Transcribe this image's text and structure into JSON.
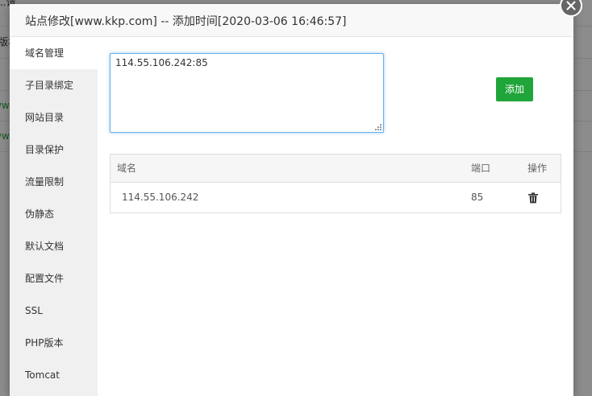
{
  "background": {
    "lines": [
      "...请...",
      "版本"
    ],
    "link_fragment": "www"
  },
  "dialog": {
    "title": "站点修改[www.kkp.com] -- 添加时间[2020-03-06 16:46:57]",
    "close_icon": "close-icon"
  },
  "sidebar": {
    "items": [
      {
        "label": "域名管理",
        "active": true
      },
      {
        "label": "子目录绑定"
      },
      {
        "label": "网站目录"
      },
      {
        "label": "目录保护"
      },
      {
        "label": "流量限制"
      },
      {
        "label": "伪静态"
      },
      {
        "label": "默认文档"
      },
      {
        "label": "配置文件"
      },
      {
        "label": "SSL"
      },
      {
        "label": "PHP版本"
      },
      {
        "label": "Tomcat"
      }
    ]
  },
  "domain_input": {
    "value": "114.55.106.242:85"
  },
  "add_button": {
    "label": "添加",
    "color": "#20a53a"
  },
  "domain_table": {
    "columns": [
      "域名",
      "端口",
      "操作"
    ],
    "rows": [
      {
        "domain": "114.55.106.242",
        "port": "85",
        "action_icon": "trash-icon"
      }
    ]
  }
}
